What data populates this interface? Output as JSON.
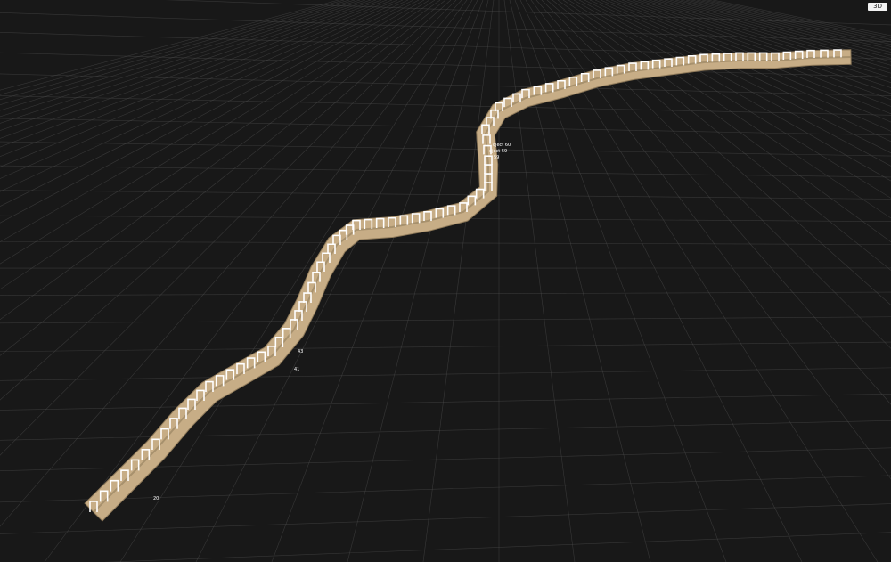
{
  "viewport": {
    "view_mode_label": "3D",
    "background_color": "#181818",
    "grid_color": "#505050"
  },
  "scene": {
    "terrain_color": "#c7ad86",
    "camera_marker_color": "#ffffff",
    "point_labels": [
      {
        "id": "label-1",
        "text": "oject 60"
      },
      {
        "id": "label-2",
        "text": "oject 59"
      },
      {
        "id": "label-3",
        "text": "59"
      },
      {
        "id": "label-4",
        "text": "43"
      },
      {
        "id": "label-5",
        "text": "41"
      },
      {
        "id": "label-6",
        "text": "20"
      }
    ]
  }
}
